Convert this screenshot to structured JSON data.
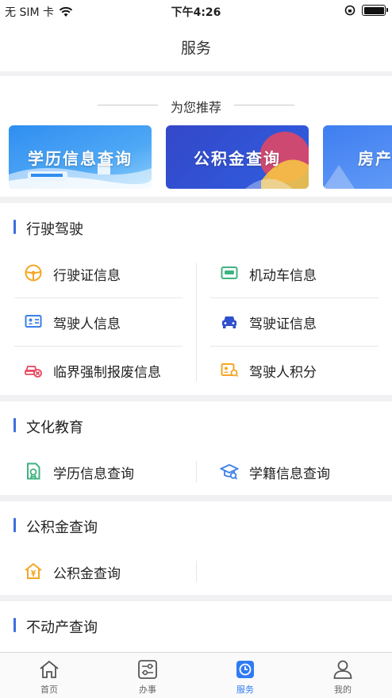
{
  "status_bar": {
    "carrier": "无 SIM 卡",
    "time": "下午4:26"
  },
  "nav": {
    "title": "服务"
  },
  "recommend": {
    "title": "为您推荐",
    "banners": [
      {
        "label": "学历信息查询"
      },
      {
        "label": "公积金查询"
      },
      {
        "label": "房产"
      }
    ]
  },
  "sections": [
    {
      "title": "行驶驾驶",
      "items": [
        {
          "label": "行驶证信息",
          "icon": "steering-wheel-icon"
        },
        {
          "label": "机动车信息",
          "icon": "vehicle-card-icon"
        },
        {
          "label": "驾驶人信息",
          "icon": "id-card-icon"
        },
        {
          "label": "驾驶证信息",
          "icon": "car-front-icon"
        },
        {
          "label": "临界强制报废信息",
          "icon": "scrap-car-icon"
        },
        {
          "label": "驾驶人积分",
          "icon": "score-card-icon"
        }
      ]
    },
    {
      "title": "文化教育",
      "items": [
        {
          "label": "学历信息查询",
          "icon": "certificate-icon"
        },
        {
          "label": "学籍信息查询",
          "icon": "graduation-cap-icon"
        }
      ]
    },
    {
      "title": "公积金查询",
      "items": [
        {
          "label": "公积金查询",
          "icon": "house-fund-icon"
        }
      ]
    },
    {
      "title": "不动产查询",
      "items": []
    }
  ],
  "tabbar": {
    "tabs": [
      {
        "label": "首页",
        "icon": "home-icon"
      },
      {
        "label": "办事",
        "icon": "settings-sliders-icon"
      },
      {
        "label": "服务",
        "icon": "clock-icon",
        "active": true
      },
      {
        "label": "我的",
        "icon": "person-icon"
      }
    ]
  },
  "colors": {
    "accent": "#2f7bf5",
    "section_bar": "#3b6fe0",
    "orange": "#f5a623",
    "green": "#3fb37f"
  }
}
